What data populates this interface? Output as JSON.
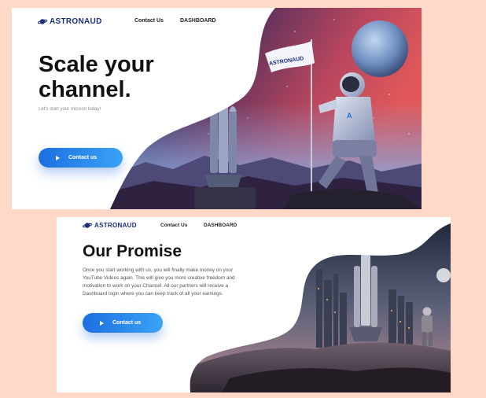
{
  "brand": {
    "name": "ASTRONAUD",
    "color": "#1b2e7a"
  },
  "nav": {
    "contact_label": "Contact Us",
    "dashboard_label": "DASHBOARD"
  },
  "hero": {
    "headline_line1": "Scale your",
    "headline_line2": "channel.",
    "tagline": "Let's start your mission today!",
    "cta_label": "Contact us",
    "flag_text": "ASTRONAUD",
    "suit_letter": "A"
  },
  "promise": {
    "headline": "Our Promise",
    "body": "Once you start working with us, you will finally make money on your YouTube Videos again. This will give you more creative freedom and motivation to work on your Channel. All our partners will receive a Dashboard login where you can keep track of all your earnings.",
    "cta_label": "Contact us"
  },
  "colors": {
    "background": "#ffd8c7",
    "accent": "#1d6fe0",
    "accent_light": "#3aa3f6"
  },
  "icons": [
    "planet-logo-icon",
    "play-icon"
  ]
}
